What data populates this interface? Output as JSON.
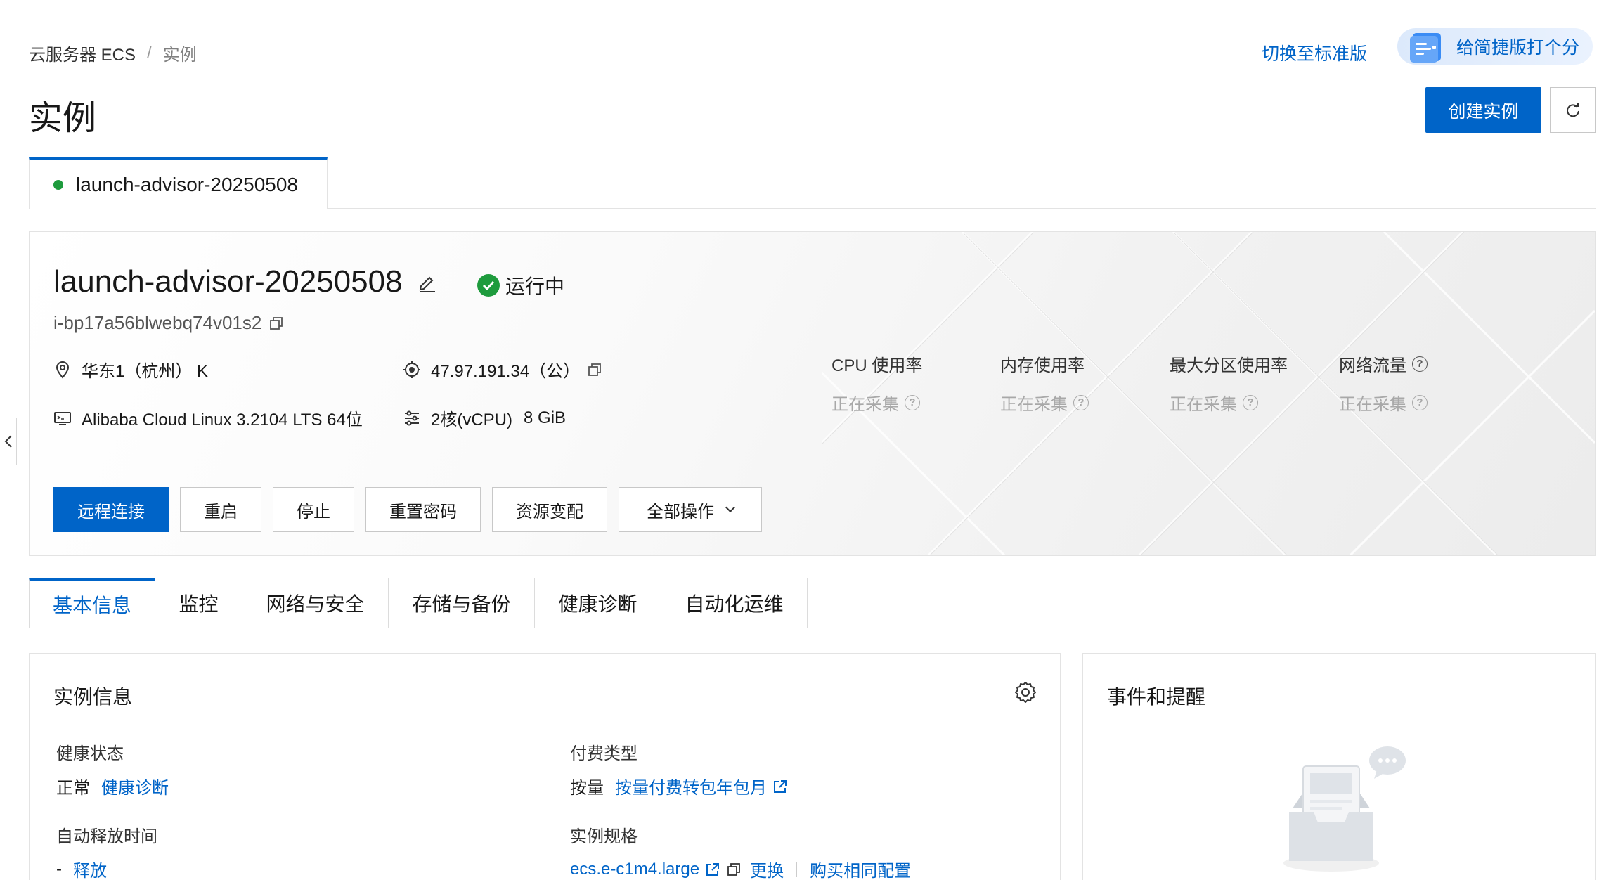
{
  "breadcrumb": {
    "root": "云服务器 ECS",
    "separator": "/",
    "current": "实例"
  },
  "page_title": "实例",
  "header": {
    "switch_link": "切换至标准版",
    "feedback_label": "给简捷版打个分",
    "create_button": "创建实例"
  },
  "instance_tab": {
    "label": "launch-advisor-20250508"
  },
  "instance": {
    "name": "launch-advisor-20250508",
    "status": "运行中",
    "id": "i-bp17a56blwebq74v01s2",
    "region": "华东1（杭州） K",
    "ip": "47.97.191.34（公）",
    "os": "Alibaba Cloud Linux 3.2104 LTS 64位",
    "cpu": "2核(vCPU)",
    "memory": "8 GiB"
  },
  "metrics": [
    {
      "label": "CPU 使用率",
      "value": "正在采集"
    },
    {
      "label": "内存使用率",
      "value": "正在采集"
    },
    {
      "label": "最大分区使用率",
      "value": "正在采集"
    },
    {
      "label": "网络流量",
      "value": "正在采集"
    }
  ],
  "actions": [
    "远程连接",
    "重启",
    "停止",
    "重置密码",
    "资源变配",
    "全部操作"
  ],
  "section_tabs": [
    "基本信息",
    "监控",
    "网络与安全",
    "存储与备份",
    "健康诊断",
    "自动化运维"
  ],
  "instance_info": {
    "title": "实例信息",
    "health_label": "健康状态",
    "health_value": "正常",
    "health_link": "健康诊断",
    "billing_label": "付费类型",
    "billing_value": "按量",
    "billing_link": "按量付费转包年包月",
    "release_label": "自动释放时间",
    "release_value": "-",
    "release_link": "释放",
    "spec_label": "实例规格",
    "spec_value": "ecs.e-c1m4.large",
    "spec_change": "更换",
    "spec_buy": "购买相同配置"
  },
  "events": {
    "title": "事件和提醒"
  },
  "colors": {
    "primary": "#0064c8",
    "running": "#1e9b3d"
  }
}
